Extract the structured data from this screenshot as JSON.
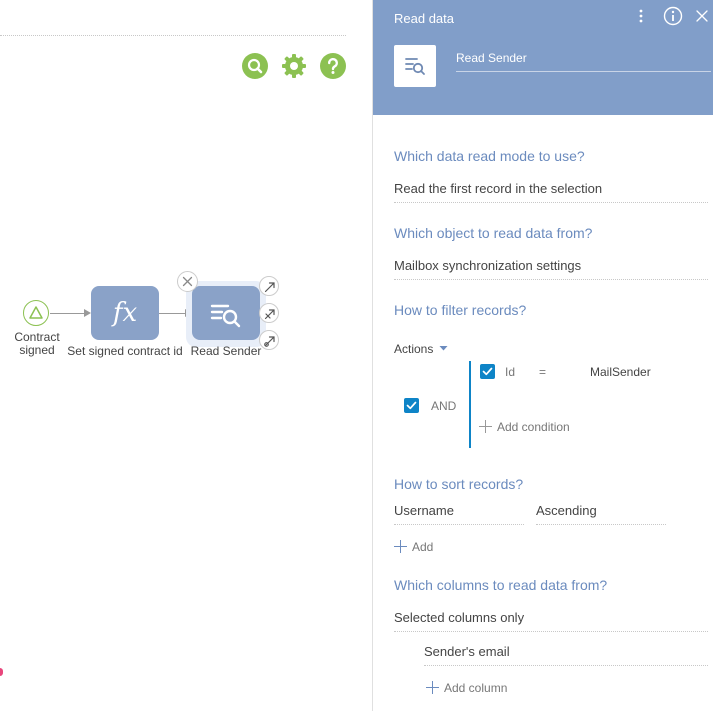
{
  "canvas": {
    "tools": [
      {
        "icon": "search-icon",
        "color": "#8cc152"
      },
      {
        "icon": "gear-icon",
        "color": "#8cc152"
      },
      {
        "icon": "help-icon",
        "color": "#8cc152"
      }
    ],
    "nodes": {
      "start_label": "Contract signed",
      "formula_label": "Set signed contract id",
      "read_label": "Read Sender"
    }
  },
  "panel": {
    "title": "Read data",
    "element_name": "Read Sender",
    "header_color": "#819ec9",
    "read_mode": {
      "question": "Which data read mode to use?",
      "value": "Read the first record in the selection"
    },
    "object": {
      "question": "Which object to read data from?",
      "value": "Mailbox synchronization settings"
    },
    "filter": {
      "question": "How to filter records?",
      "actions_label": "Actions",
      "group_operator": "AND",
      "condition": {
        "column": "Id",
        "operator": "=",
        "value": "MailSender"
      },
      "add_condition_label": "Add condition"
    },
    "sort": {
      "question": "How to sort records?",
      "column": "Username",
      "direction": "Ascending",
      "add_label": "Add"
    },
    "columns": {
      "question": "Which columns to read data from?",
      "mode": "Selected columns only",
      "items": [
        "Sender's email"
      ],
      "add_column_label": "Add column"
    }
  }
}
